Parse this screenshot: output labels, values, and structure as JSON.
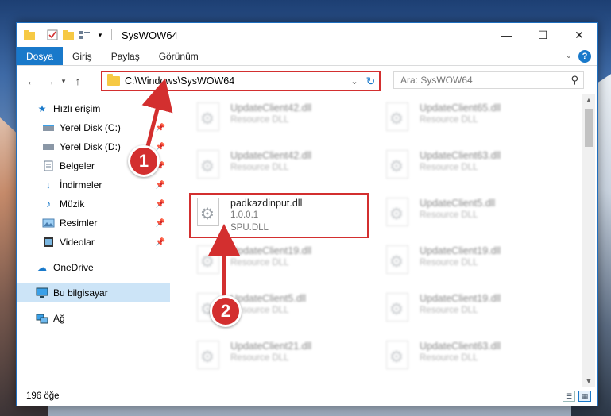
{
  "window": {
    "title": "SysWOW64",
    "controls": {
      "minimize": "—",
      "maximize": "☐",
      "close": "✕"
    }
  },
  "ribbon": {
    "tabs": [
      "Dosya",
      "Giriş",
      "Paylaş",
      "Görünüm"
    ]
  },
  "address": {
    "path": "C:\\Windows\\SysWOW64",
    "search_placeholder": "Ara: SysWOW64"
  },
  "sidebar": {
    "quick_access": "Hızlı erişim",
    "items": [
      {
        "label": "Yerel Disk (C:)",
        "icon": "drive-icon"
      },
      {
        "label": "Yerel Disk (D:)",
        "icon": "drive-icon"
      },
      {
        "label": "Belgeler",
        "icon": "documents-icon"
      },
      {
        "label": "İndirmeler",
        "icon": "downloads-icon"
      },
      {
        "label": "Müzik",
        "icon": "music-icon"
      },
      {
        "label": "Resimler",
        "icon": "pictures-icon"
      },
      {
        "label": "Videolar",
        "icon": "videos-icon"
      }
    ],
    "onedrive": "OneDrive",
    "this_pc": "Bu bilgisayar",
    "network": "Ağ"
  },
  "files": {
    "left": [
      {
        "name": "UpdateClient42.dll",
        "sub1": "Resource DLL",
        "sub2": ""
      },
      {
        "name": "UpdateClient42.dll",
        "sub1": "Resource DLL",
        "sub2": ""
      },
      {
        "name": "padkazdinput.dll",
        "sub1": "1.0.0.1",
        "sub2": "SPU.DLL"
      },
      {
        "name": "UpdateClient19.dll",
        "sub1": "Resource DLL",
        "sub2": ""
      },
      {
        "name": "UpdateClient5.dll",
        "sub1": "Resource DLL",
        "sub2": ""
      },
      {
        "name": "UpdateClient21.dll",
        "sub1": "Resource DLL",
        "sub2": ""
      }
    ],
    "right": [
      {
        "name": "UpdateClient65.dll",
        "sub1": "Resource DLL"
      },
      {
        "name": "UpdateClient63.dll",
        "sub1": "Resource DLL"
      },
      {
        "name": "UpdateClient5.dll",
        "sub1": "Resource DLL"
      },
      {
        "name": "UpdateClient19.dll",
        "sub1": "Resource DLL"
      },
      {
        "name": "UpdateClient19.dll",
        "sub1": "Resource DLL"
      },
      {
        "name": "UpdateClient63.dll",
        "sub1": "Resource DLL"
      }
    ]
  },
  "status": {
    "count": "196 öğe"
  },
  "annotations": {
    "step1": "1",
    "step2": "2"
  },
  "colors": {
    "accent": "#1979ca",
    "highlight": "#d32f2f"
  }
}
